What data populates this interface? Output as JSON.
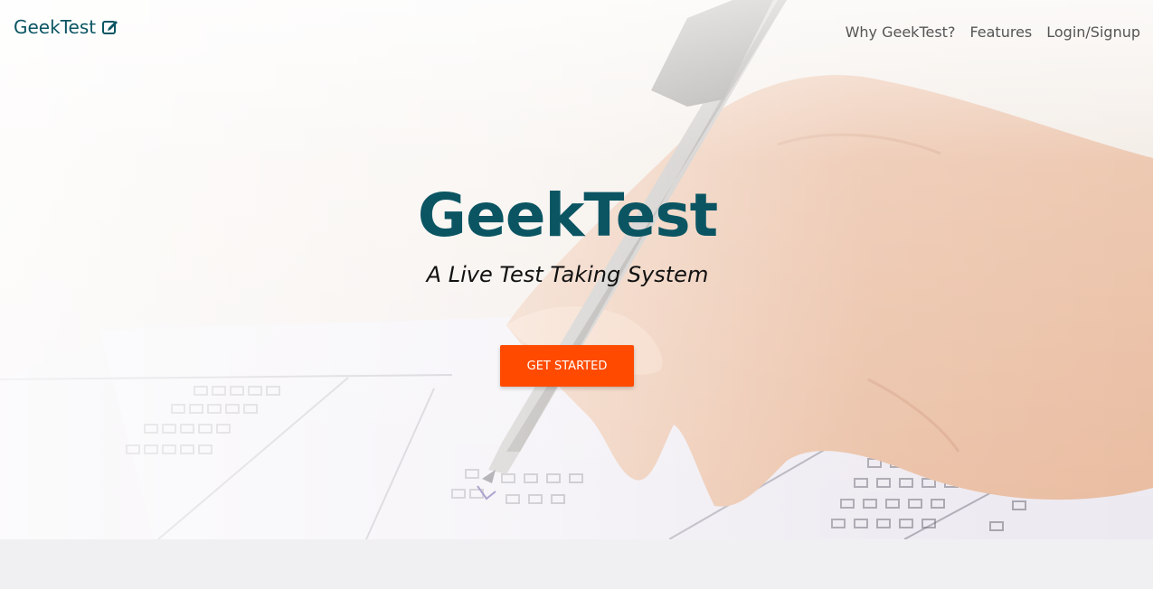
{
  "navbar": {
    "brand": "GeekTest",
    "brand_icon": "edit-icon",
    "links": [
      {
        "label": "Why GeekTest?"
      },
      {
        "label": "Features"
      },
      {
        "label": "Login/Signup"
      }
    ]
  },
  "hero": {
    "title": "GeekTest",
    "subtitle": "A Live Test Taking System",
    "cta_label": "GET STARTED",
    "background_image": "hand-writing-answer-sheet"
  },
  "colors": {
    "brand": "#0b5563",
    "cta": "#ff4a00",
    "page_bg": "#f0f0f2"
  }
}
